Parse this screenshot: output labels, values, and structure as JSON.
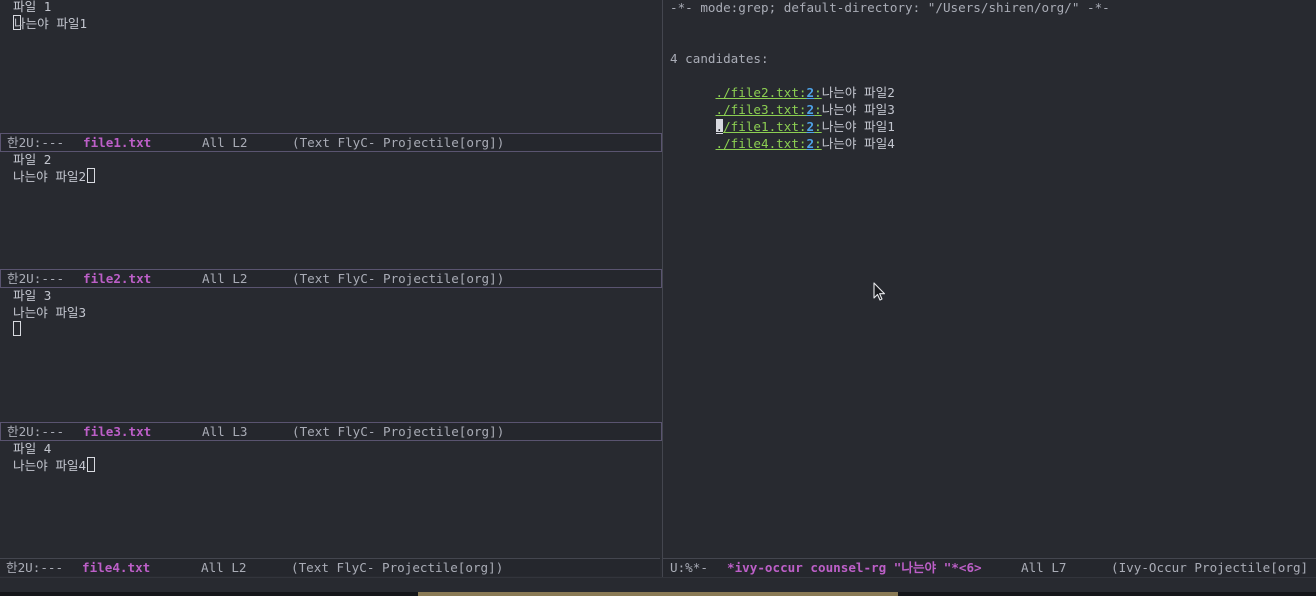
{
  "panes": [
    {
      "lines": [
        "파일 1",
        "나는야 파일1"
      ],
      "cursor_line": 1,
      "cursor_position": "start",
      "modeline": {
        "status": "한2U:---",
        "buffer_name": "file1.txt",
        "position": "All L2",
        "modes": "(Text FlyC- Projectile[org])"
      }
    },
    {
      "lines": [
        "파일 2",
        "나는야 파일2"
      ],
      "cursor_line": 1,
      "cursor_position": "end",
      "modeline": {
        "status": "한2U:---",
        "buffer_name": "file2.txt",
        "position": "All L2",
        "modes": "(Text FlyC- Projectile[org])"
      }
    },
    {
      "lines": [
        "파일 3",
        "나는야 파일3",
        ""
      ],
      "cursor_line": 2,
      "cursor_position": "start",
      "modeline": {
        "status": "한2U:---",
        "buffer_name": "file3.txt",
        "position": "All L3",
        "modes": "(Text FlyC- Projectile[org])"
      }
    },
    {
      "lines": [
        "파일 4",
        "나는야 파일4"
      ],
      "cursor_line": 1,
      "cursor_position": "end",
      "modeline": {
        "status": "한2U:---",
        "buffer_name": "file4.txt",
        "position": "All L2",
        "modes": "(Text FlyC- Projectile[org])"
      }
    }
  ],
  "occur": {
    "header": "-*- mode:grep; default-directory: \"/Users/shiren/org/\" -*-",
    "candidates_label": "4 candidates:",
    "candidates": [
      {
        "file": "./file2.txt",
        "line": "2",
        "text": "나는야 파일2",
        "current": false
      },
      {
        "file": "./file3.txt",
        "line": "2",
        "text": "나는야 파일3",
        "current": false
      },
      {
        "file": "./file1.txt",
        "line": "2",
        "text": "나는야 파일1",
        "current": true
      },
      {
        "file": "./file4.txt",
        "line": "2",
        "text": "나는야 파일4",
        "current": false
      }
    ],
    "modeline": {
      "status": "U:%*-",
      "buffer_name": "*ivy-occur counsel-rg \"나는야 \"*<6>",
      "position": "All L7",
      "modes": "(Ivy-Occur Projectile[org]"
    }
  },
  "colors": {
    "background": "#282a30",
    "buffer_name": "#bd5fc8",
    "file_link": "#8ccf52",
    "line_number": "#4ea3e8",
    "modeline_border": "#5a5470"
  },
  "icons": {
    "mouse_pointer": "arrow-cursor-icon"
  }
}
